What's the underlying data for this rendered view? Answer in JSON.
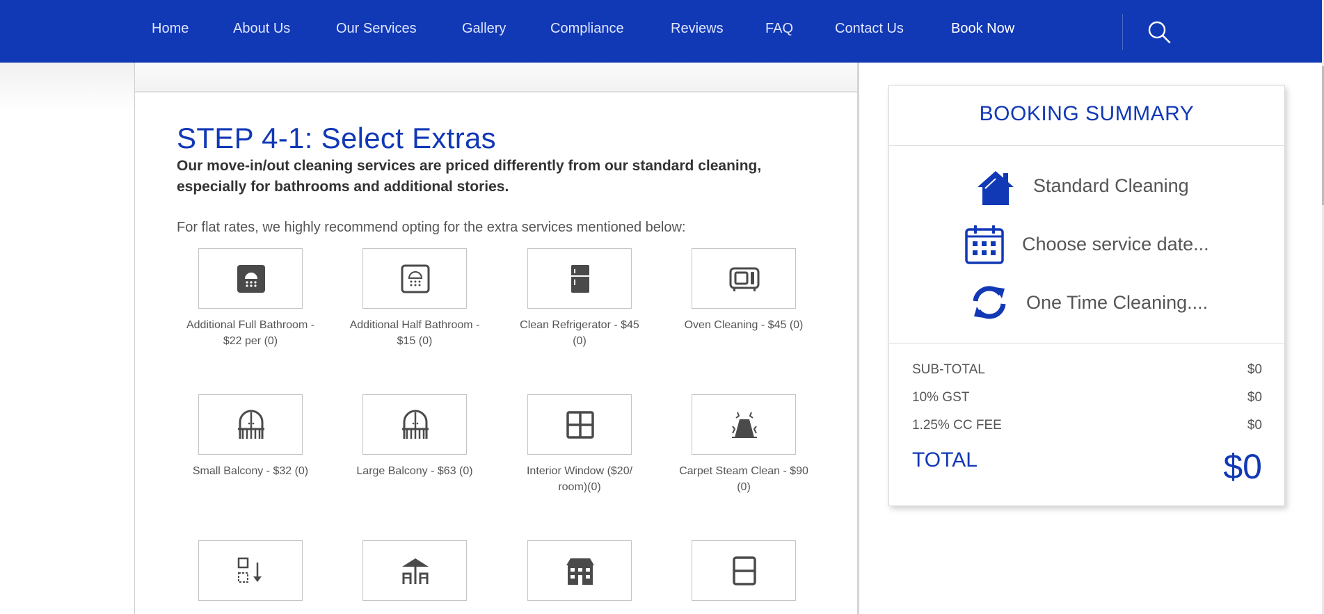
{
  "nav": {
    "items": [
      "Home",
      "About Us",
      "Our Services",
      "Gallery",
      "Compliance",
      "Reviews",
      "FAQ",
      "Contact Us",
      "Book Now"
    ],
    "active": "Book Now"
  },
  "step": {
    "title": "STEP 4-1: Select Extras",
    "description": "Our move-in/out cleaning services are priced differently from our standard cleaning, especially for bathrooms and additional stories.",
    "note": "For flat rates, we highly recommend opting for the extra services mentioned below:"
  },
  "extras": [
    {
      "label": "Additional Full Bathroom - $22 per (0)",
      "icon": "full-bathroom-icon"
    },
    {
      "label": "Additional Half Bathroom - $15 (0)",
      "icon": "half-bathroom-icon"
    },
    {
      "label": "Clean Refrigerator - $45 (0)",
      "icon": "refrigerator-icon"
    },
    {
      "label": "Oven Cleaning - $45 (0)",
      "icon": "oven-icon"
    },
    {
      "label": "Small Balcony - $32 (0)",
      "icon": "small-balcony-icon"
    },
    {
      "label": "Large Balcony - $63 (0)",
      "icon": "large-balcony-icon"
    },
    {
      "label": "Interior Window ($20/ room)(0)",
      "icon": "window-icon"
    },
    {
      "label": "Carpet Steam Clean - $90 (0)",
      "icon": "carpet-icon"
    },
    {
      "label": "",
      "icon": "ceiling-icon"
    },
    {
      "label": "",
      "icon": "porch-icon"
    },
    {
      "label": "",
      "icon": "house-building-icon"
    },
    {
      "label": "",
      "icon": "blind-window-icon"
    }
  ],
  "summary": {
    "title": "BOOKING SUMMARY",
    "service": "Standard Cleaning",
    "date": "Choose service date...",
    "frequency": "One Time Cleaning....",
    "subtotal_label": "SUB-TOTAL",
    "subtotal_value": "$0",
    "gst_label": "10% GST",
    "gst_value": "$0",
    "cc_label": "1.25% CC FEE",
    "cc_value": "$0",
    "total_label": "TOTAL",
    "total_value": "$0"
  },
  "colors": {
    "brand_blue": "#1138b5",
    "icon_gray": "#4a4a4a"
  }
}
